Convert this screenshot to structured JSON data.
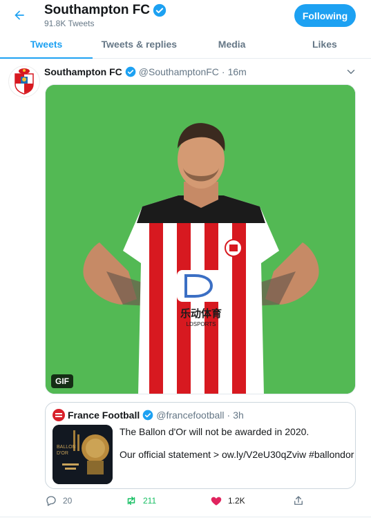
{
  "header": {
    "name": "Southampton FC",
    "tweet_count": "91.8K Tweets",
    "follow_label": "Following"
  },
  "tabs": [
    {
      "label": "Tweets",
      "active": true
    },
    {
      "label": "Tweets & replies",
      "active": false
    },
    {
      "label": "Media",
      "active": false
    },
    {
      "label": "Likes",
      "active": false
    }
  ],
  "tweet": {
    "name": "Southampton FC",
    "handle": "@SouthamptonFC",
    "dot": "·",
    "time": "16m",
    "media_badge": "GIF",
    "jersey_sponsor": "乐动体育",
    "jersey_sponsor_sub": "LDSPORTS",
    "quote": {
      "name": "France Football",
      "handle": "@francefootball",
      "dot": "·",
      "time": "3h",
      "text1": "The Ballon d'Or will not be awarded in 2020.",
      "text2": "Our official statement > ow.ly/V2eU30qZviw #ballondor",
      "thumb_text": [
        "BALLON",
        "D'OR"
      ]
    },
    "actions": {
      "reply_count": "20",
      "retweet_count": "211",
      "like_count": "1.2K"
    }
  },
  "colors": {
    "accent": "#1da1f2",
    "retweet": "#17bf63",
    "like": "#e0245e",
    "gif_background": "#4bb54c"
  },
  "icons": {
    "back": "arrow-left-icon",
    "verified": "verified-badge-icon",
    "caret": "chevron-down-icon",
    "reply": "reply-icon",
    "retweet": "retweet-icon",
    "like": "heart-icon",
    "share": "share-icon"
  }
}
